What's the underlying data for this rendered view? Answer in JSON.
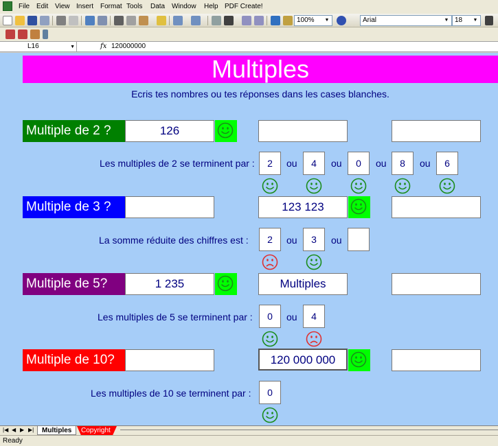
{
  "menu": [
    "File",
    "Edit",
    "View",
    "Insert",
    "Format",
    "Tools",
    "Data",
    "Window",
    "Help",
    "PDF Create!"
  ],
  "toolbar": {
    "zoom": "100%",
    "font": "Arial",
    "font_size": "18"
  },
  "formula_bar": {
    "cell_ref": "L16",
    "fx": "fx",
    "value": "120000000"
  },
  "sheet": {
    "title": "Multiples",
    "instruction": "Ecris tes nombres ou tes réponses dans les cases blanches.",
    "row2": {
      "label": "Multiple de 2 ?",
      "label_color": "#008000",
      "answer1": "126",
      "answer2": "",
      "answer3": "",
      "rule_text": "Les multiples de 2 se terminent par :",
      "digits": [
        "2",
        "4",
        "0",
        "8",
        "6"
      ],
      "ou": "ou",
      "faces": [
        "happy",
        "happy",
        "happy",
        "happy",
        "happy"
      ]
    },
    "row3": {
      "label": "Multiple de 3 ?",
      "label_color": "#0000ff",
      "answer1": "",
      "answer2": "123 123",
      "answer3": "",
      "rule_text": "La somme réduite des chiffres est :",
      "digits": [
        "2",
        "3",
        ""
      ],
      "ou": "ou",
      "faces": [
        "sad",
        "happy"
      ]
    },
    "row5": {
      "label": "Multiple de 5?",
      "label_color": "#800080",
      "answer1": "1 235",
      "answer2": "Multiples",
      "answer3": "",
      "rule_text": "Les multiples de 5 se terminent par :",
      "digits": [
        "0",
        "4"
      ],
      "ou": "ou",
      "faces": [
        "happy",
        "sad"
      ]
    },
    "row10": {
      "label": "Multiple de 10?",
      "label_color": "#ff0000",
      "answer1": "",
      "answer2": "120 000 000",
      "answer3": "",
      "rule_text": "Les multiples de 10 se terminent par :",
      "digits": [
        "0"
      ],
      "faces": [
        "happy"
      ]
    }
  },
  "tabs": [
    "Multiples",
    "Copyright"
  ],
  "status": "Ready",
  "colors": {
    "happy": "#1a8c1a",
    "sad": "#e03030",
    "green_box": "#00ff00"
  }
}
